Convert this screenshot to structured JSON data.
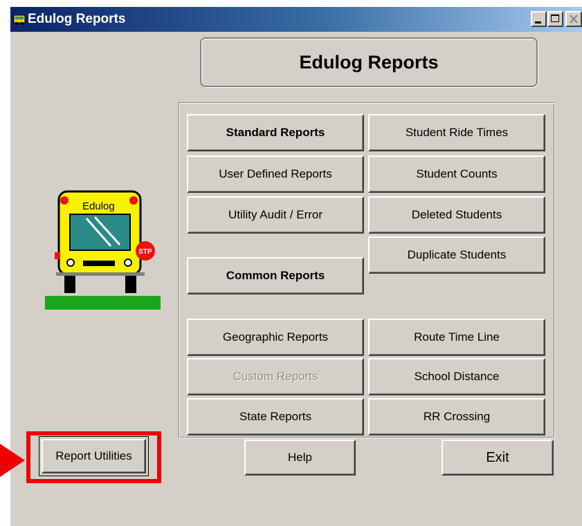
{
  "window": {
    "title": "Edulog Reports",
    "controls": [
      "minimize-icon",
      "maximize-icon",
      "close-icon"
    ]
  },
  "header": {
    "title": "Edulog Reports"
  },
  "logo": {
    "bus_label": "Edulog",
    "stop_sign": "STP"
  },
  "buttons": {
    "standard_reports": "Standard Reports",
    "user_defined_reports": "User Defined Reports",
    "utility_audit_error": "Utility Audit / Error",
    "common_reports": "Common Reports",
    "geographic_reports": "Geographic Reports",
    "custom_reports": "Custom Reports",
    "state_reports": "State Reports",
    "student_ride_times": "Student Ride Times",
    "student_counts": "Student Counts",
    "deleted_students": "Deleted Students",
    "duplicate_students": "Duplicate Students",
    "route_time_line": "Route Time Line",
    "school_distance": "School Distance",
    "rr_crossing": "RR Crossing",
    "report_utilities": "Report Utilities",
    "help": "Help",
    "exit": "Exit"
  },
  "colors": {
    "annotation": "#ee0000",
    "face": "#d4d0c8",
    "titlebar": "#0a246a"
  }
}
